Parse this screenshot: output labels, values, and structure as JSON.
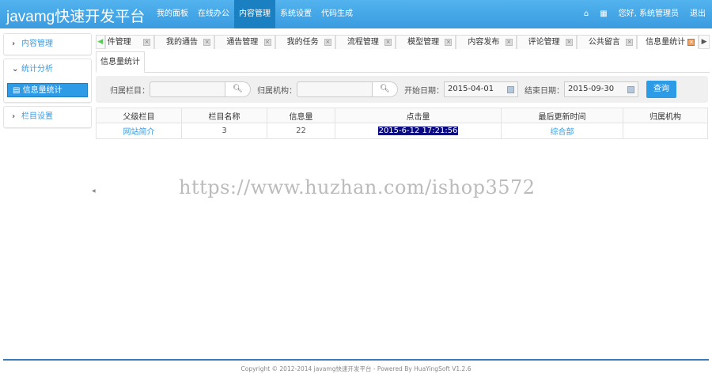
{
  "header": {
    "logo": "javamg快速开发平台",
    "nav": [
      "我的面板",
      "在线办公",
      "内容管理",
      "系统设置",
      "代码生成"
    ],
    "active_nav": "内容管理",
    "greeting": "您好, 系统管理员",
    "logout": "退出"
  },
  "sidebar": {
    "groups": [
      {
        "label": "内容管理",
        "expanded": false
      },
      {
        "label": "统计分析",
        "expanded": true,
        "items": [
          "信息量统计"
        ]
      },
      {
        "label": "栏目设置",
        "expanded": false
      }
    ]
  },
  "tabs": [
    "件管理",
    "我的通告",
    "通告管理",
    "我的任务",
    "流程管理",
    "模型管理",
    "内容发布",
    "评论管理",
    "公共留言",
    "信息量统计"
  ],
  "active_tab": "信息量统计",
  "content_tab": "信息量统计",
  "filter": {
    "category_label": "归属栏目：",
    "category_value": "",
    "office_label": "归属机构：",
    "office_value": "",
    "start_label": "开始日期：",
    "start_value": "2015-04-01",
    "end_label": "结束日期：",
    "end_value": "2015-09-30",
    "query": "查询"
  },
  "table": {
    "headers": [
      "父级栏目",
      "栏目名称",
      "信息量",
      "点击量",
      "最后更新时间",
      "归属机构"
    ],
    "rows": [
      [
        "网站简介",
        "3",
        "22",
        "2015-6-12 17:21:56",
        "综合部",
        ""
      ]
    ]
  },
  "watermark": "https://www.huzhan.com/ishop3572",
  "footer": "Copyright © 2012-2014 javamg快速开发平台 - Powered By HuaYingSoft V1.2.6"
}
